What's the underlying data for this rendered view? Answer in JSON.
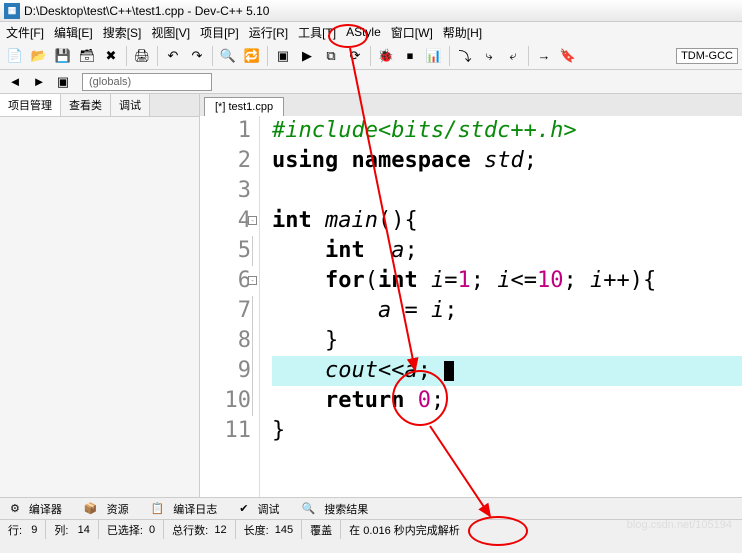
{
  "title": "D:\\Desktop\\test\\C++\\test1.cpp - Dev-C++ 5.10",
  "menu": [
    "文件[F]",
    "编辑[E]",
    "搜索[S]",
    "视图[V]",
    "项目[P]",
    "运行[R]",
    "工具[T]",
    "AStyle",
    "窗口[W]",
    "帮助[H]"
  ],
  "compiler": "TDM-GCC",
  "globals": "(globals)",
  "sidetabs": [
    "项目管理",
    "查看类",
    "调试"
  ],
  "editor_tab": "[*] test1.cpp",
  "lines": [
    "1",
    "2",
    "3",
    "4",
    "5",
    "6",
    "7",
    "8",
    "9",
    "10",
    "11"
  ],
  "code": {
    "l1a": "#include",
    "l1b": "<bits/stdc++.h>",
    "l2a": "using",
    "l2b": "namespace",
    "l2c": "std",
    "l2d": ";",
    "l4a": "int",
    "l4b": "main",
    "l4c": "(){",
    "l5a": "    ",
    "l5b": "int",
    "l5c": "  ",
    "l5d": "a",
    "l5e": ";",
    "l6a": "    ",
    "l6b": "for",
    "l6c": "(",
    "l6d": "int",
    "l6e": " ",
    "l6f": "i",
    "l6g": "=",
    "l6h": "1",
    "l6i": "; ",
    "l6j": "i",
    "l6k": "<=",
    "l6l": "10",
    "l6m": "; ",
    "l6n": "i",
    "l6o": "++){",
    "l7a": "        ",
    "l7b": "a",
    "l7c": " = ",
    "l7d": "i",
    "l7e": ";",
    "l8a": "    }",
    "l9a": "    ",
    "l9b": "cout",
    "l9c": "<<",
    "l9d": "a",
    "l9e": "; ",
    "l10a": "    ",
    "l10b": "return",
    "l10c": " ",
    "l10d": "0",
    "l10e": ";",
    "l11a": "}"
  },
  "bottom": {
    "compiler": "编译器",
    "res": "资源",
    "log": "编译日志",
    "debug": "调试",
    "search": "搜索结果"
  },
  "status": {
    "line_lbl": "行:",
    "line_val": "9",
    "col_lbl": "列:",
    "col_val": "14",
    "sel_lbl": "已选择:",
    "sel_val": "0",
    "total_lbl": "总行数:",
    "total_val": "12",
    "len_lbl": "长度:",
    "len_val": "145",
    "mode": "覆盖",
    "parse": "在 0.016 秒内完成解析"
  },
  "watermark": "blog.csdn.net/105194"
}
